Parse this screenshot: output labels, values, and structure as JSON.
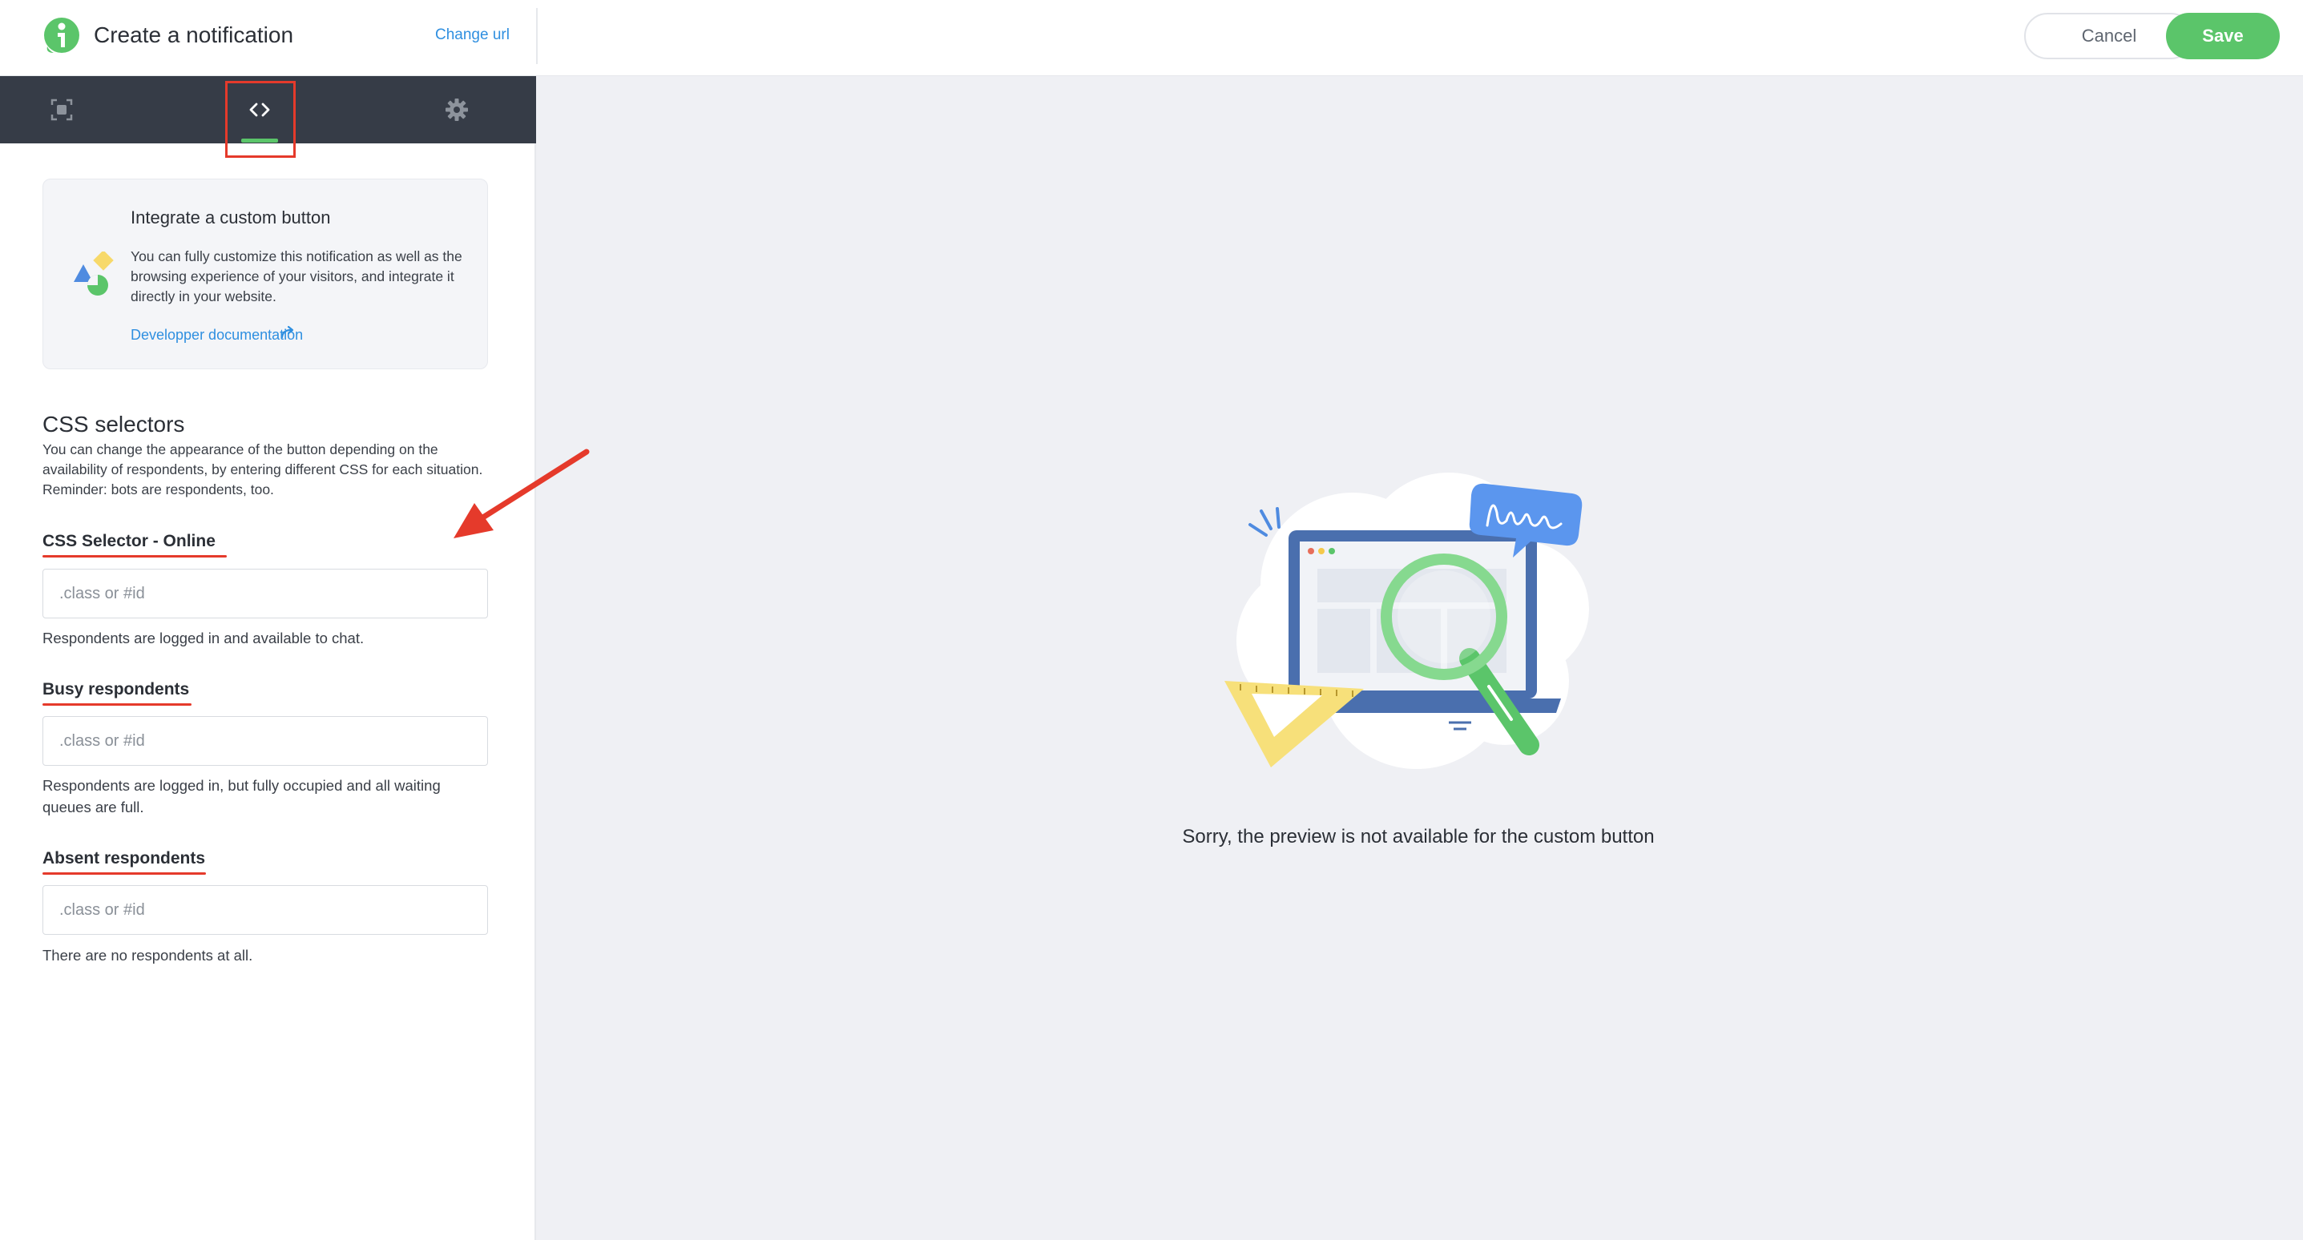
{
  "header": {
    "title": "Create a notification",
    "change_url": "Change url",
    "cancel_label": "Cancel",
    "save_label": "Save"
  },
  "sidebar": {
    "tabs": [
      {
        "name": "preview-tab",
        "icon": "focus-frame-icon",
        "active": false
      },
      {
        "name": "code-tab",
        "icon": "code-brackets-icon",
        "active": true
      },
      {
        "name": "settings-tab",
        "icon": "gear-icon",
        "active": false
      }
    ],
    "card": {
      "title": "Integrate a custom button",
      "text": "You can fully customize this notification as well as the browsing experience of your visitors, and integrate it directly in your website.",
      "link": "Developper documentation",
      "link_icon": "share-arrow-icon"
    },
    "section": {
      "title": "CSS selectors",
      "description": "You can change the appearance of the button depending on the availability of respondents, by entering different CSS for each situation. Reminder: bots are respondents, too."
    },
    "fields": [
      {
        "label": "CSS Selector - Online",
        "placeholder": ".class or #id",
        "value": "",
        "hint": "Respondents are logged in and available to chat."
      },
      {
        "label": "Busy respondents",
        "placeholder": ".class or #id",
        "value": "",
        "hint": "Respondents are logged in, but fully occupied and all waiting queues are full."
      },
      {
        "label": "Absent respondents",
        "placeholder": ".class or #id",
        "value": "",
        "hint": "There are no respondents at all."
      }
    ]
  },
  "main": {
    "message": "Sorry, the preview is not available for the custom button",
    "illustration": "laptop-magnifier-illustration"
  },
  "colors": {
    "accent_green": "#5bc56a",
    "link_blue": "#2f8fe0",
    "tabbar_dark": "#363c47",
    "annotation_red": "#e53a2b",
    "preview_bg": "#eff0f4"
  }
}
